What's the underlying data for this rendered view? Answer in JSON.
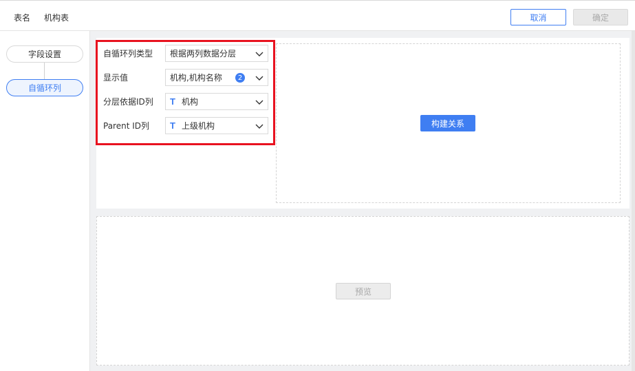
{
  "header": {
    "table_label": "表名",
    "table_name": "机构表",
    "cancel_label": "取消",
    "confirm_label": "确定"
  },
  "sidebar": {
    "steps": [
      {
        "label": "字段设置",
        "active": false
      },
      {
        "label": "自循环列",
        "active": true
      }
    ]
  },
  "form": {
    "rows": [
      {
        "label": "自循环列类型",
        "value": "根据两列数据分层"
      },
      {
        "label": "显示值",
        "value": "机构,机构名称",
        "badge": "2"
      },
      {
        "label": "分层依据ID列",
        "value": "机构",
        "type_icon": "T"
      },
      {
        "label": "Parent ID列",
        "value": "上级机构",
        "type_icon": "T"
      }
    ]
  },
  "actions": {
    "build_label": "构建关系",
    "preview_label": "预览"
  },
  "colors": {
    "accent": "#3f7ef2",
    "highlight": "#e8121f",
    "disabled_text": "#a8a8a8"
  }
}
